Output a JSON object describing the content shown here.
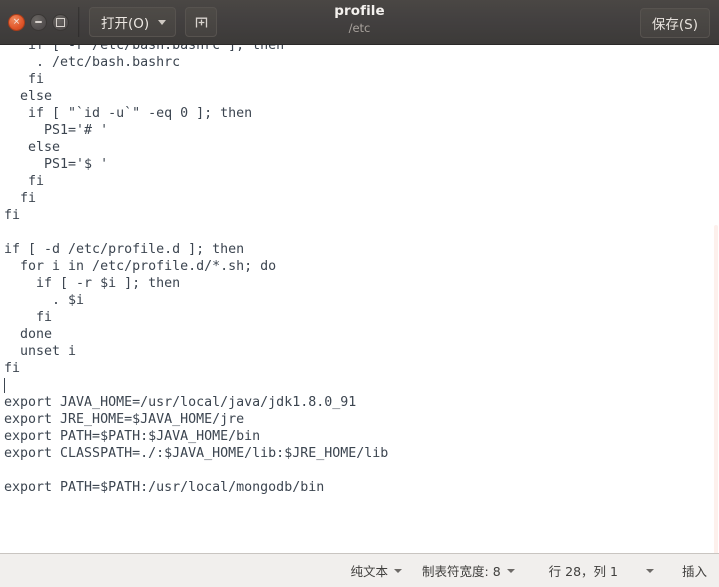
{
  "window": {
    "controls": [
      {
        "name": "close",
        "glyph": "×"
      },
      {
        "name": "minimize",
        "glyph": ""
      },
      {
        "name": "maximize",
        "glyph": ""
      }
    ],
    "title": "profile",
    "subtitle": "/etc"
  },
  "toolbar": {
    "open_label": "打开(O)",
    "open_caret_icon": "chevron-down-icon",
    "new_document_icon": "new-document-icon",
    "save_label": "保存(S)"
  },
  "editor": {
    "lines": [
      "   if [ -r /etc/bash.bashrc ]; then",
      "    . /etc/bash.bashrc",
      "   fi",
      "  else",
      "   if [ \"`id -u`\" -eq 0 ]; then",
      "     PS1='# '",
      "   else",
      "     PS1='$ '",
      "   fi",
      "  fi",
      "fi",
      "",
      "if [ -d /etc/profile.d ]; then",
      "  for i in /etc/profile.d/*.sh; do",
      "    if [ -r $i ]; then",
      "      . $i",
      "    fi",
      "  done",
      "  unset i",
      "fi",
      "",
      "export JAVA_HOME=/usr/local/java/jdk1.8.0_91",
      "export JRE_HOME=$JAVA_HOME/jre",
      "export PATH=$PATH:$JAVA_HOME/bin",
      "export CLASSPATH=./:$JAVA_HOME/lib:$JRE_HOME/lib",
      "",
      "export PATH=$PATH:/usr/local/mongodb/bin"
    ],
    "cursor_line_index": 20,
    "text_color": "#3c4550",
    "background_color": "#ffffff"
  },
  "statusbar": {
    "language_label": "纯文本",
    "tab_width_label": "制表符宽度: 8",
    "position_label": "行 28，列 1",
    "insert_mode_label": "插入"
  },
  "colors": {
    "titlebar": "#434040",
    "close_button": "#e1562a",
    "statusbar_bg": "#f1efed",
    "scrollbar": "#fdf0ec"
  }
}
